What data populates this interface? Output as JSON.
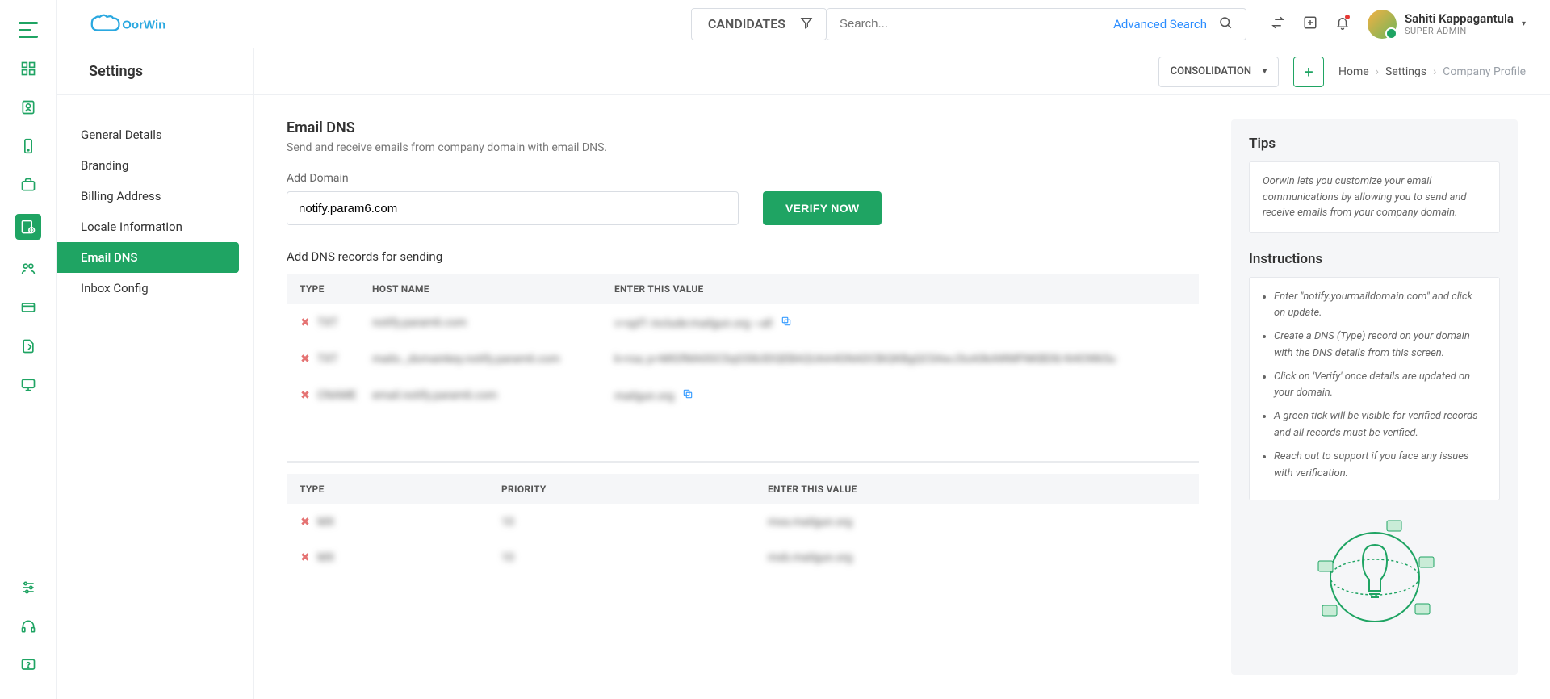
{
  "header": {
    "search_category": "CANDIDATES",
    "search_placeholder": "Search...",
    "advanced_search": "Advanced Search",
    "user_name": "Sahiti Kappagantula",
    "user_role": "SUPER ADMIN"
  },
  "subheader": {
    "title": "Settings",
    "consolidation_label": "CONSOLIDATION",
    "crumb_home": "Home",
    "crumb_settings": "Settings",
    "crumb_current": "Company Profile"
  },
  "settings_nav": {
    "items": [
      "General Details",
      "Branding",
      "Billing Address",
      "Locale Information",
      "Email DNS",
      "Inbox Config"
    ]
  },
  "page": {
    "title": "Email DNS",
    "subtitle": "Send and receive emails from company domain with email DNS.",
    "add_domain_label": "Add Domain",
    "domain_value": "notify.param6.com",
    "verify_label": "VERIFY NOW",
    "sending_label": "Add DNS records for sending",
    "sending_cols": {
      "type": "TYPE",
      "host": "HOST NAME",
      "value": "ENTER THIS VALUE"
    },
    "sending_rows": [
      {
        "type": "TXT",
        "host": "notify.param6.com",
        "value": "v=spf1 include:mailgun.org ~all"
      },
      {
        "type": "TXT",
        "host": "mailo._domainkey.notify.param6.com",
        "value": "k=rsa; p=MIGfMA0GCSqGSIb3DQEBAQUAA4GNADCBiQKBgQC0AwJ3oA0kAWMFNKBD8/4i4OWk5u"
      },
      {
        "type": "CNAME",
        "host": "email.notify.param6.com",
        "value": "mailgun.org"
      }
    ],
    "recv_cols": {
      "type": "TYPE",
      "priority": "PRIORITY",
      "value": "ENTER THIS VALUE"
    },
    "recv_rows": [
      {
        "type": "MX",
        "priority": "10",
        "value": "mxa.mailgun.org"
      },
      {
        "type": "MX",
        "priority": "10",
        "value": "mxb.mailgun.org"
      }
    ]
  },
  "tips": {
    "heading": "Tips",
    "body": "Oorwin lets you customize your email communications by allowing you to send and receive emails from your company domain.",
    "instructions_heading": "Instructions",
    "instructions": [
      "Enter \"notify.yourmaildomain.com\" and click on update.",
      "Create a DNS (Type) record on your domain with the DNS details from this screen.",
      "Click on 'Verify' once details are updated on your domain.",
      "A green tick will be visible for verified records and all records must be verified.",
      "Reach out to support if you face any issues with verification."
    ]
  }
}
